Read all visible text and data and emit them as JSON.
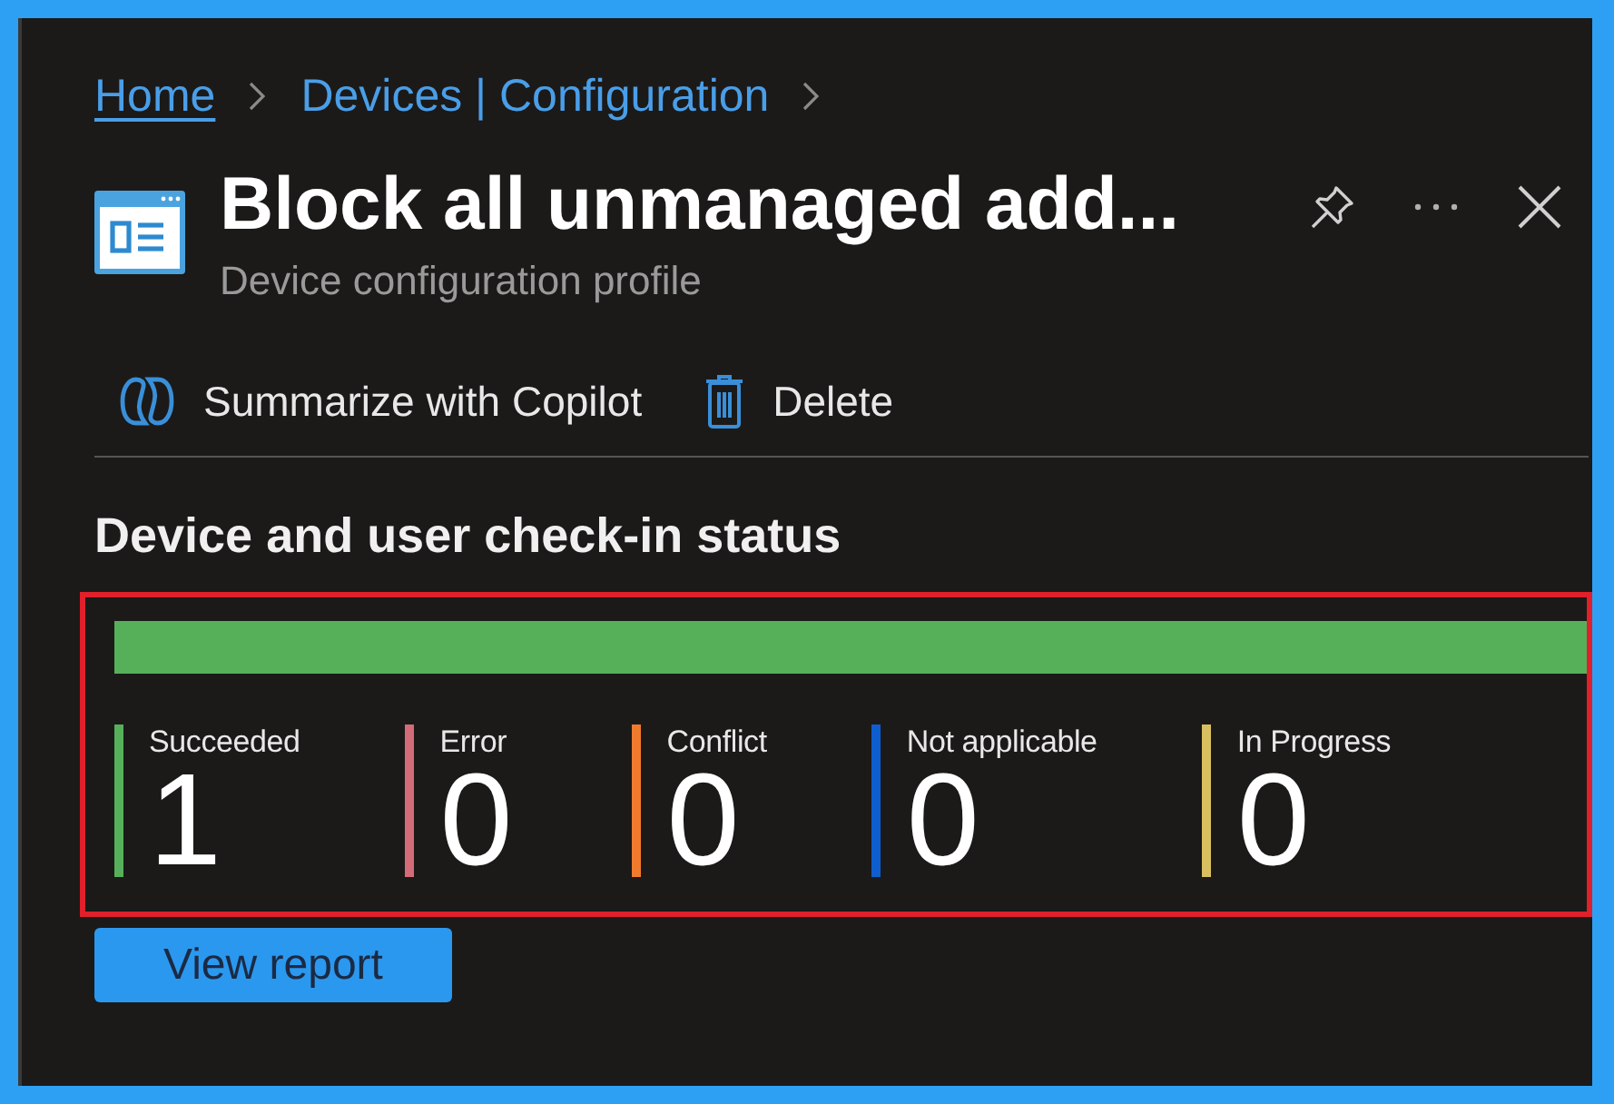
{
  "breadcrumb": [
    {
      "label": "Home",
      "underlined": true
    },
    {
      "label": "Devices | Configuration",
      "underlined": false
    }
  ],
  "header": {
    "title": "Block all unmanaged add...",
    "subtitle": "Device configuration profile"
  },
  "toolbar": [
    {
      "kind": "copilot",
      "label": "Summarize with Copilot"
    },
    {
      "kind": "delete",
      "label": "Delete"
    }
  ],
  "checkin": {
    "heading": "Device and user check-in status",
    "status_bar": {
      "level": 1
    },
    "statuses": [
      {
        "label": "Succeeded",
        "count": "1",
        "color": "#56b05a"
      },
      {
        "label": "Error",
        "count": "0",
        "color": "#d46b78"
      },
      {
        "label": "Conflict",
        "count": "0",
        "color": "#f17b2c"
      },
      {
        "label": "Not applicable",
        "count": "0",
        "color": "#0e5ed0"
      },
      {
        "label": "In Progress",
        "count": "0",
        "color": "#d8c060"
      }
    ]
  },
  "view_report_button": "View report"
}
